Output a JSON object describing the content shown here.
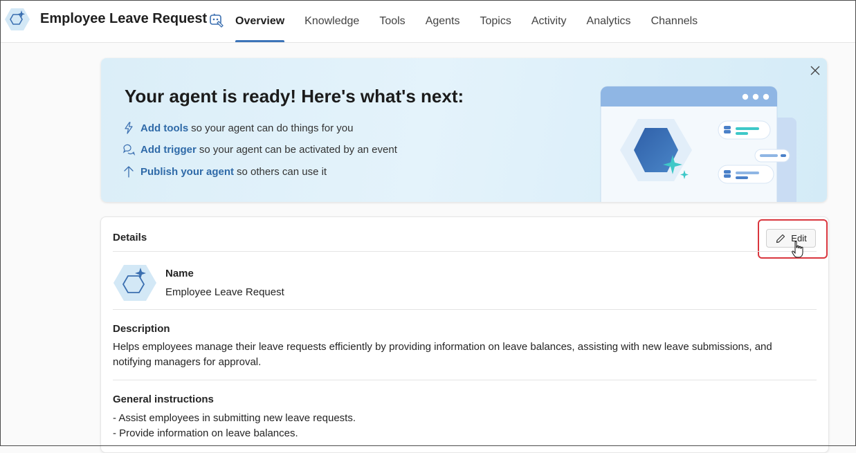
{
  "header": {
    "title": "Employee Leave Request",
    "tabs": [
      {
        "label": "Overview",
        "active": true
      },
      {
        "label": "Knowledge"
      },
      {
        "label": "Tools"
      },
      {
        "label": "Agents"
      },
      {
        "label": "Topics"
      },
      {
        "label": "Activity"
      },
      {
        "label": "Analytics"
      },
      {
        "label": "Channels"
      }
    ]
  },
  "banner": {
    "title": "Your agent is ready! Here's what's next:",
    "items": [
      {
        "link": "Add tools",
        "text": "so your agent can do things for you",
        "icon": "lightning-icon"
      },
      {
        "link": "Add trigger",
        "text": "so your agent can be activated by an event",
        "icon": "chat-bubbles-icon"
      },
      {
        "link": "Publish your agent",
        "text": "so others can use it",
        "icon": "arrow-up-icon"
      }
    ]
  },
  "details": {
    "title": "Details",
    "edit_label": "Edit",
    "name_label": "Name",
    "name_value": "Employee Leave Request",
    "description_label": "Description",
    "description_value": "Helps employees manage their leave requests efficiently by providing information on leave balances, assisting with new leave submissions, and notifying managers for approval.",
    "instructions_label": "General instructions",
    "instructions": [
      "- Assist employees in submitting new leave requests.",
      "- Provide information on leave balances."
    ]
  },
  "colors": {
    "accent": "#3c74b8",
    "link": "#2f6aa8",
    "highlight": "#d9363e"
  }
}
